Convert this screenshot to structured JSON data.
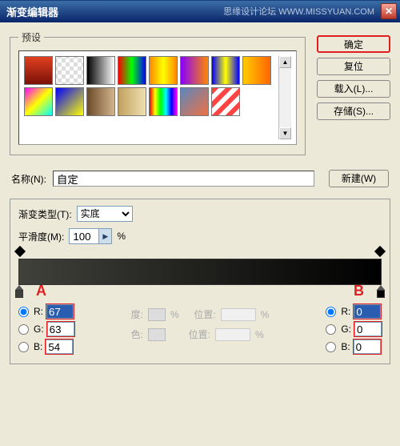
{
  "window": {
    "title": "渐变编辑器",
    "watermark": "思缘设计论坛  WWW.MISSYUAN.COM"
  },
  "presets": {
    "legend": "预设",
    "swatches": [
      "linear-gradient(to bottom,#e04020,#7a1008)",
      "repeating-conic-gradient(#ddd 0 25%, #fff 0 50%) 50%/10px 10px",
      "linear-gradient(to right,#000,#fff)",
      "linear-gradient(to right,#f00,#0f0,#00f)",
      "linear-gradient(to right,#f80,#ff0,#f80)",
      "linear-gradient(to right,#80f,#f80)",
      "linear-gradient(to right,#00f,#ff0,#00f)",
      "linear-gradient(to right,#fc0,#f60)",
      "linear-gradient(135deg,#f0f,#ff0,#0ff)",
      "linear-gradient(135deg,#00f,#ff0)",
      "linear-gradient(to right,#6b4a2a,#d2b48c)",
      "linear-gradient(to right,#c0a060,#f0e0b0)",
      "linear-gradient(to right,#f00,#ff0,#0f0,#0ff,#00f,#f0f)",
      "linear-gradient(135deg,#5a88c0,#f07040)",
      "repeating-linear-gradient(135deg,#f44,#f44 6px,#fff 6px,#fff 12px)"
    ]
  },
  "buttons": {
    "ok": "确定",
    "reset": "复位",
    "load": "载入(L)...",
    "save": "存储(S)...",
    "new": "新建(W)"
  },
  "name": {
    "label": "名称(N):",
    "value": "自定"
  },
  "gradient": {
    "type_label": "渐变类型(T):",
    "type_value": "实底",
    "smooth_label": "平滑度(M):",
    "smooth_value": "100",
    "percent": "%",
    "markerA": "A",
    "markerB": "B"
  },
  "left_rgb": {
    "R_label": "R:",
    "R": "67",
    "G_label": "G:",
    "G": "63",
    "B_label": "B:",
    "B": "54"
  },
  "right_rgb": {
    "R_label": "R:",
    "R": "0",
    "G_label": "G:",
    "G": "0",
    "B_label": "B:",
    "B": "0"
  },
  "mid": {
    "opacity_label": "度:",
    "pos_label": "位置:",
    "pct": "%",
    "color_label": "色:",
    "pos2_label": "位置:"
  }
}
